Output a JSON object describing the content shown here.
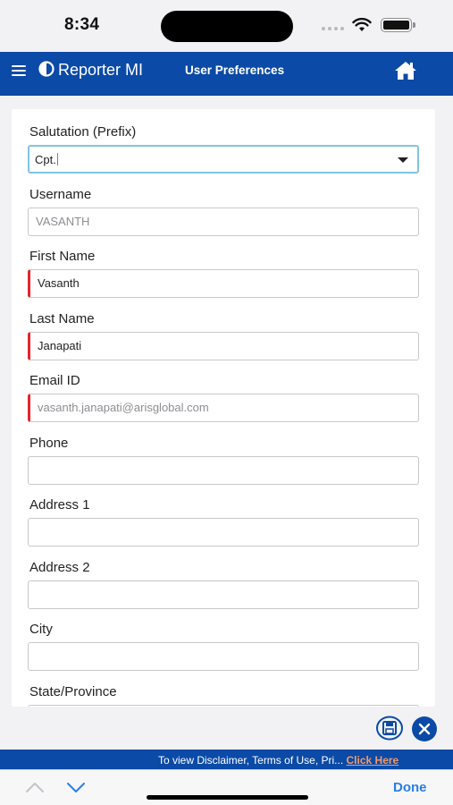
{
  "status_bar": {
    "time": "8:34"
  },
  "header": {
    "brand": "Reporter MI",
    "title": "User Preferences"
  },
  "form": {
    "salutation": {
      "label": "Salutation (Prefix)",
      "value": "Cpt."
    },
    "username": {
      "label": "Username",
      "value": "VASANTH"
    },
    "first_name": {
      "label": "First Name",
      "value": "Vasanth"
    },
    "last_name": {
      "label": "Last Name",
      "value": "Janapati"
    },
    "email": {
      "label": "Email ID",
      "value": "vasanth.janapati@arisglobal.com"
    },
    "phone": {
      "label": "Phone",
      "value": ""
    },
    "address1": {
      "label": "Address 1",
      "value": ""
    },
    "address2": {
      "label": "Address 2",
      "value": ""
    },
    "city": {
      "label": "City",
      "value": ""
    },
    "state": {
      "label": "State/Province",
      "value": ""
    }
  },
  "footer": {
    "text": "To view Disclaimer, Terms of Use, Pri...",
    "link": "Click Here"
  },
  "accessory": {
    "done_label": "Done"
  },
  "colors": {
    "header_bg": "#0b4aa6",
    "required_marker": "#e2252b",
    "link": "#f29a6a",
    "done": "#2a7ee4"
  },
  "icons": [
    "menu-icon",
    "logo-icon",
    "home-icon",
    "save-icon",
    "close-icon",
    "chevron-up-icon",
    "chevron-down-icon",
    "wifi-icon",
    "battery-icon",
    "dropdown-arrow-icon"
  ]
}
